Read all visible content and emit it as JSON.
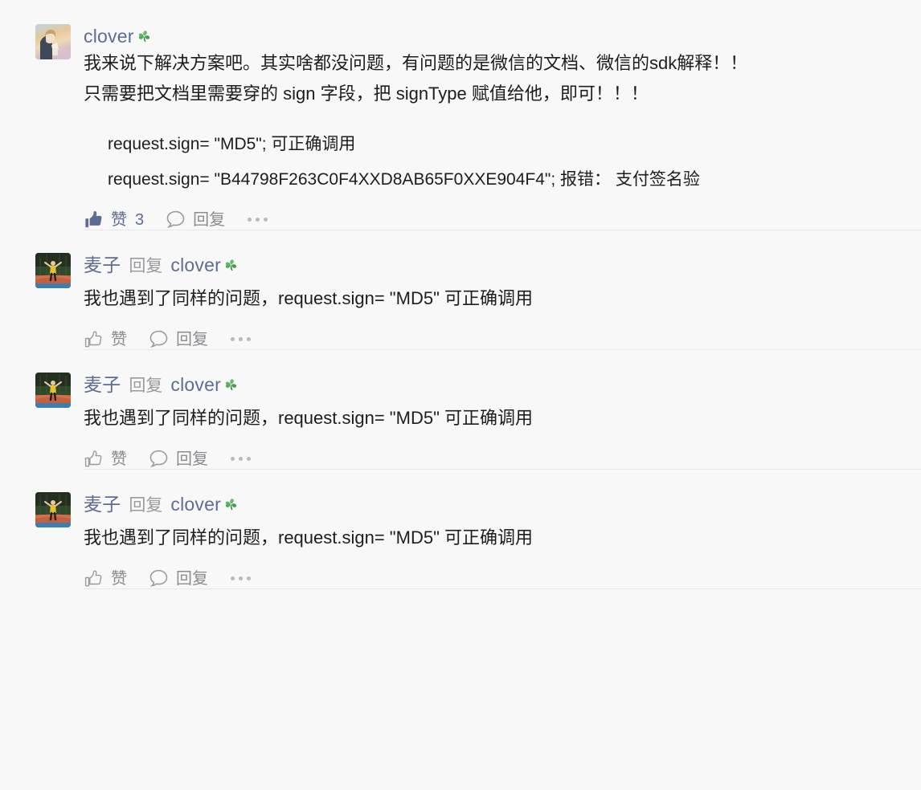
{
  "theme": {
    "background": "#f8f8f9",
    "username_color": "#5d6d92",
    "text_color": "#1d1d1f",
    "muted_color": "#8b8b90",
    "separator_color": "#e7e7e9",
    "clover_color": "#4caf50"
  },
  "main_comment": {
    "author": "clover",
    "author_badge_icon": "four-leaf-clover-icon",
    "avatar_icon": "anime-portrait-avatar",
    "paragraphs": [
      "我来说下解决方案吧。其实啥都没问题，有问题的是微信的文档、微信的sdk解释！！",
      "只需要把文档里需要穿的 sign 字段，把 signType 赋值给他，即可！！！"
    ],
    "code_lines": [
      "request.sign= \"MD5\";   可正确调用",
      "request.sign= \"B44798F263C0F4XXD8AB65F0XXE904F4\"; 报错：  支付签名验"
    ],
    "actions": {
      "like_icon": "thumbs-up-filled-icon",
      "like_label": "赞",
      "like_count": "3",
      "comment_icon": "speech-bubble-icon",
      "reply_label": "回复",
      "more_icon": "ellipsis-icon",
      "liked": true
    }
  },
  "replies": [
    {
      "author": "麦子",
      "reply_word": "回复",
      "target": "clover",
      "target_badge_icon": "four-leaf-clover-icon",
      "avatar_icon": "sports-court-avatar",
      "text": "我也遇到了同样的问题，request.sign= \"MD5\" 可正确调用",
      "actions": {
        "like_icon": "thumbs-up-outline-icon",
        "like_label": "赞",
        "comment_icon": "speech-bubble-icon",
        "reply_label": "回复",
        "more_icon": "ellipsis-icon",
        "liked": false
      }
    },
    {
      "author": "麦子",
      "reply_word": "回复",
      "target": "clover",
      "target_badge_icon": "four-leaf-clover-icon",
      "avatar_icon": "sports-court-avatar",
      "text": "我也遇到了同样的问题，request.sign= \"MD5\" 可正确调用",
      "actions": {
        "like_icon": "thumbs-up-outline-icon",
        "like_label": "赞",
        "comment_icon": "speech-bubble-icon",
        "reply_label": "回复",
        "more_icon": "ellipsis-icon",
        "liked": false
      }
    },
    {
      "author": "麦子",
      "reply_word": "回复",
      "target": "clover",
      "target_badge_icon": "four-leaf-clover-icon",
      "avatar_icon": "sports-court-avatar",
      "text": "我也遇到了同样的问题，request.sign= \"MD5\" 可正确调用",
      "actions": {
        "like_icon": "thumbs-up-outline-icon",
        "like_label": "赞",
        "comment_icon": "speech-bubble-icon",
        "reply_label": "回复",
        "more_icon": "ellipsis-icon",
        "liked": false
      }
    }
  ]
}
